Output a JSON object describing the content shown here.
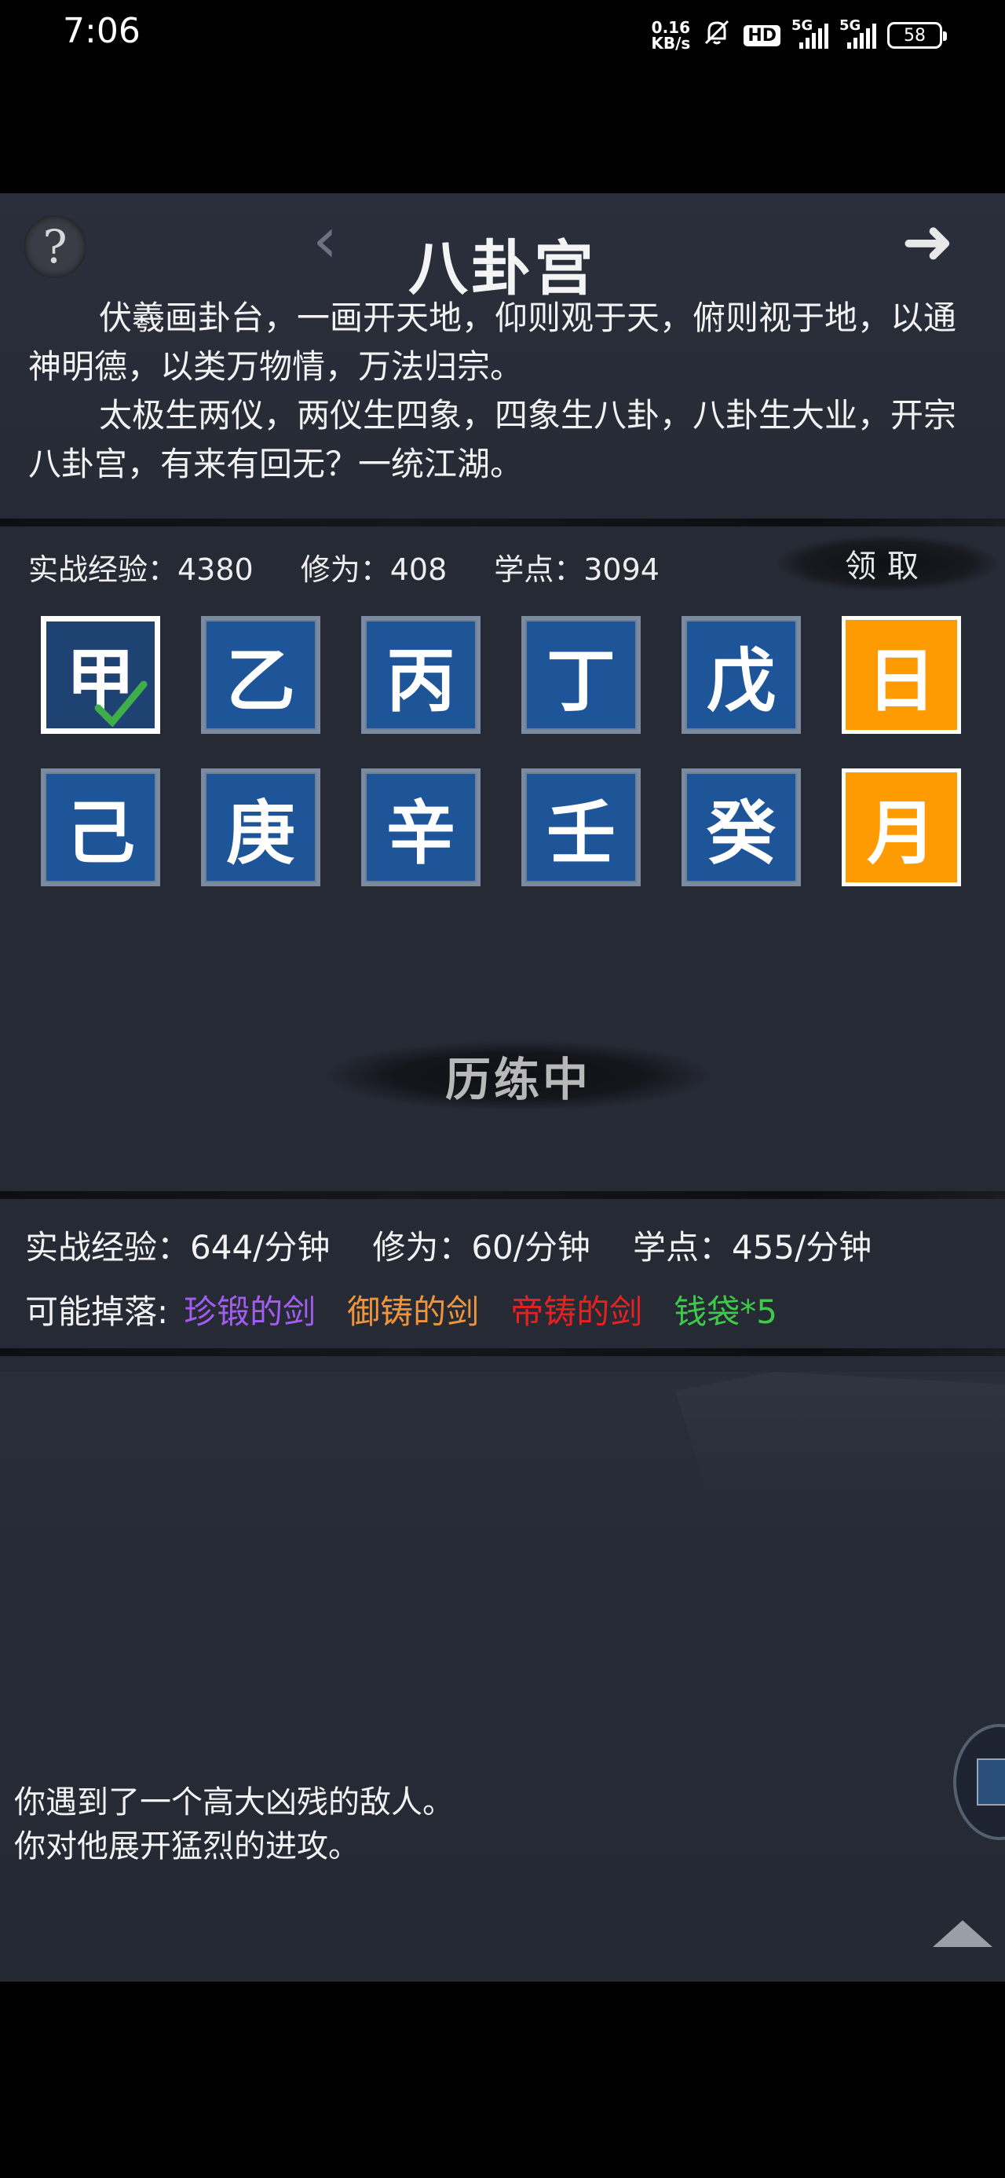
{
  "status_bar": {
    "time": "7:06",
    "net_speed_value": "0.16",
    "net_speed_unit": "KB/s",
    "hd_label": "HD",
    "signal1_label": "5G",
    "signal2_label": "5G",
    "battery": "58",
    "icons": [
      "mute-bell-icon",
      "signal-icon",
      "battery-icon"
    ]
  },
  "header": {
    "help_label": "?",
    "prev_label": "‹",
    "title": "八卦宫",
    "next_label": "➜"
  },
  "intro": {
    "paragraph1": "伏羲画卦台，一画开天地，仰则观于天，俯则视于地，以通神明德，以类万物情，万法归宗。",
    "paragraph2": "太极生两仪，两仪生四象，四象生八卦，八卦生大业，开宗八卦宫，有来有回无？一统江湖。"
  },
  "stats": {
    "exp": "实战经验：4380",
    "cultivation": "修为：408",
    "points": "学点：3094",
    "claim_label": "领取"
  },
  "tiles": [
    {
      "label": "甲",
      "type": "selected"
    },
    {
      "label": "乙",
      "type": "normal"
    },
    {
      "label": "丙",
      "type": "normal"
    },
    {
      "label": "丁",
      "type": "normal"
    },
    {
      "label": "戊",
      "type": "normal"
    },
    {
      "label": "日",
      "type": "special"
    },
    {
      "label": "己",
      "type": "normal"
    },
    {
      "label": "庚",
      "type": "normal"
    },
    {
      "label": "辛",
      "type": "normal"
    },
    {
      "label": "壬",
      "type": "normal"
    },
    {
      "label": "癸",
      "type": "normal"
    },
    {
      "label": "月",
      "type": "special"
    }
  ],
  "training_label": "历练中",
  "rates": {
    "exp": "实战经验：644/分钟",
    "cultivation": "修为：60/分钟",
    "points": "学点：455/分钟"
  },
  "drops": {
    "label": "可能掉落:",
    "items": [
      {
        "name": "珍锻的剑",
        "color": "#a25cf0"
      },
      {
        "name": "御铸的剑",
        "color": "#f0943a"
      },
      {
        "name": "帝铸的剑",
        "color": "#e8211f"
      },
      {
        "name": "钱袋*5",
        "color": "#3ec94a"
      }
    ]
  },
  "log": {
    "line1": "你遇到了一个高大凶残的敌人。",
    "line2": "你对他展开猛烈的进攻。"
  },
  "colors": {
    "background": "#262a35",
    "tile_blue": "#1e5498",
    "tile_orange": "#fe9a02"
  }
}
